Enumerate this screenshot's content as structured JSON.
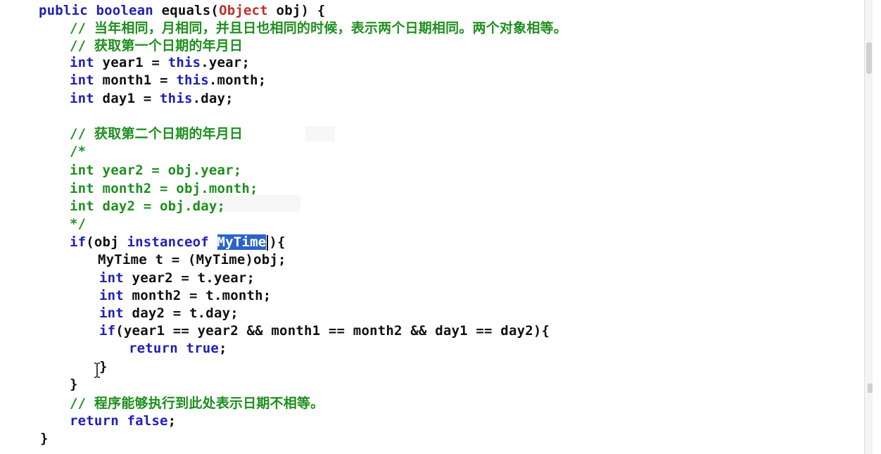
{
  "editor": {
    "lines": [
      {
        "tokens": [
          {
            "t": "public boolean",
            "c": "kw"
          },
          {
            "t": " equals(",
            "c": "plain"
          },
          {
            "t": "Object",
            "c": "type"
          },
          {
            "t": " obj) {",
            "c": "plain"
          }
        ]
      },
      {
        "tokens": [
          {
            "t": "// 当年相同，月相同，并且日也相同的时候，表示两个日期相同。两个对象相等。",
            "c": "comment"
          }
        ]
      },
      {
        "tokens": [
          {
            "t": "// 获取第一个日期的年月日",
            "c": "comment"
          }
        ]
      },
      {
        "tokens": [
          {
            "t": "int",
            "c": "kw"
          },
          {
            "t": " year1 = ",
            "c": "plain"
          },
          {
            "t": "this",
            "c": "kw"
          },
          {
            "t": ".year;",
            "c": "plain"
          }
        ]
      },
      {
        "tokens": [
          {
            "t": "int",
            "c": "kw"
          },
          {
            "t": " month1 = ",
            "c": "plain"
          },
          {
            "t": "this",
            "c": "kw"
          },
          {
            "t": ".month;",
            "c": "plain"
          }
        ]
      },
      {
        "tokens": [
          {
            "t": "int",
            "c": "kw"
          },
          {
            "t": " day1 = ",
            "c": "plain"
          },
          {
            "t": "this",
            "c": "kw"
          },
          {
            "t": ".day;",
            "c": "plain"
          }
        ]
      },
      {
        "tokens": []
      },
      {
        "tokens": [
          {
            "t": "// 获取第二个日期的年月日",
            "c": "comment"
          }
        ]
      },
      {
        "tokens": [
          {
            "t": "/*",
            "c": "comment"
          }
        ]
      },
      {
        "tokens": [
          {
            "t": "int year2 = obj.year;",
            "c": "comment"
          }
        ]
      },
      {
        "tokens": [
          {
            "t": "int month2 = obj.month;",
            "c": "comment"
          }
        ]
      },
      {
        "tokens": [
          {
            "t": "int day2 = obj.day;",
            "c": "comment"
          }
        ]
      },
      {
        "tokens": [
          {
            "t": "*/",
            "c": "comment"
          }
        ]
      },
      {
        "tokens": [
          {
            "t": "if",
            "c": "kw"
          },
          {
            "t": "(obj ",
            "c": "plain"
          },
          {
            "t": "instanceof",
            "c": "kw"
          },
          {
            "t": " ",
            "c": "plain"
          },
          {
            "t": "MyTime",
            "c": "sel"
          },
          {
            "t": "|",
            "c": "cursor"
          },
          {
            "t": "){",
            "c": "plain"
          }
        ]
      },
      {
        "tokens": [
          {
            "t": "MyTime t = (MyTime)obj;",
            "c": "plain"
          }
        ]
      },
      {
        "tokens": [
          {
            "t": "int",
            "c": "kw"
          },
          {
            "t": " year2 = t.year;",
            "c": "plain"
          }
        ]
      },
      {
        "tokens": [
          {
            "t": "int",
            "c": "kw"
          },
          {
            "t": " month2 = t.month;",
            "c": "plain"
          }
        ]
      },
      {
        "tokens": [
          {
            "t": "int",
            "c": "kw"
          },
          {
            "t": " day2 = t.day;",
            "c": "plain"
          }
        ]
      },
      {
        "tokens": [
          {
            "t": "if",
            "c": "kw"
          },
          {
            "t": "(year1 == year2 && month1 == month2 && day1 == day2){",
            "c": "plain"
          }
        ]
      },
      {
        "tokens": [
          {
            "t": "return true",
            "c": "kw"
          },
          {
            "t": ";",
            "c": "plain"
          }
        ]
      },
      {
        "tokens": [
          {
            "t": "}",
            "c": "plain"
          }
        ]
      },
      {
        "tokens": [
          {
            "t": "}",
            "c": "plain"
          }
        ]
      },
      {
        "tokens": [
          {
            "t": "// 程序能够执行到此处表示日期不相等。",
            "c": "comment"
          }
        ]
      },
      {
        "tokens": [
          {
            "t": "return false",
            "c": "kw"
          },
          {
            "t": ";",
            "c": "plain"
          }
        ]
      },
      {
        "tokens": [
          {
            "t": "}",
            "c": "plain"
          }
        ]
      }
    ]
  },
  "colors": {
    "keyword": "#1f1fb8",
    "plain": "#101010",
    "type": "#c0302a",
    "comment": "#1d8f1d",
    "selection": "#2b63c9",
    "background": "#ffffff"
  },
  "icons": {
    "mouse_cursor": "i-beam-cursor-icon",
    "text_caret": "text-caret-icon"
  }
}
